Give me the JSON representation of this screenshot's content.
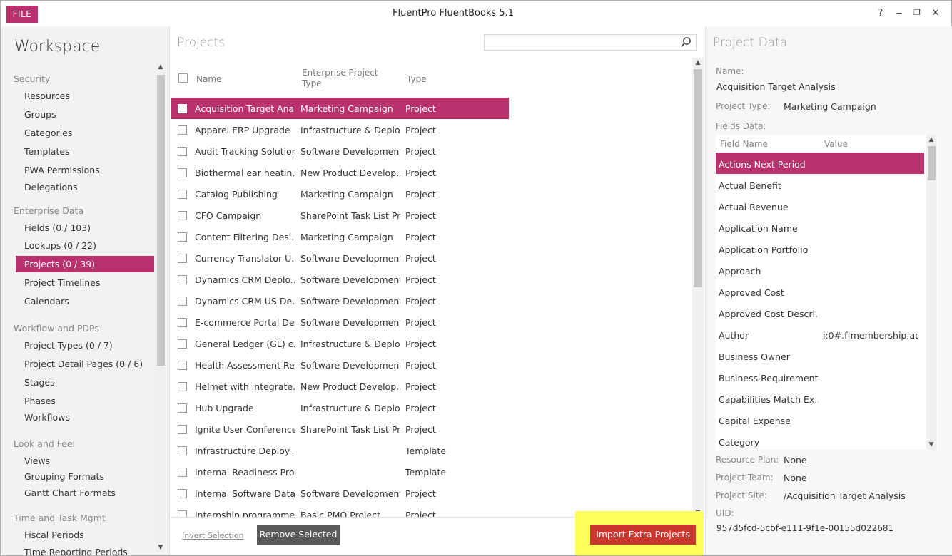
{
  "window": {
    "file_label": "FILE",
    "title": "FluentPro FluentBooks 5.1",
    "controls": [
      "?",
      "‒",
      "❐",
      "✕"
    ]
  },
  "sidebar": {
    "title": "Workspace",
    "groups": [
      {
        "label": "Security",
        "items": [
          "Resources",
          "Groups",
          "Categories",
          "Templates",
          "PWA Permissions",
          "Delegations"
        ]
      },
      {
        "label": "Enterprise Data",
        "items": [
          "Fields (0 / 103)",
          "Lookups (0 / 22)",
          "Projects (0 / 39)",
          "Project Timelines",
          "Calendars"
        ]
      },
      {
        "label": "Workflow and PDPs",
        "items": [
          "Project Types (0 / 7)",
          "Project Detail Pages (0 / 6)",
          "Stages",
          "Phases",
          "Workflows"
        ]
      },
      {
        "label": "Look and Feel",
        "items": [
          "Views",
          "Grouping Formats",
          "Gantt Chart Formats"
        ]
      },
      {
        "label": "Time and Task Mgmt",
        "items": [
          "Fiscal Periods",
          "Time Reporting Periods"
        ]
      }
    ],
    "selected": "Projects (0 / 39)"
  },
  "projects": {
    "title": "Projects",
    "search_placeholder": "",
    "columns": {
      "name": "Name",
      "ept_line1": "Enterprise Project",
      "ept_line2": "Type",
      "type": "Type"
    },
    "rows": [
      {
        "name": "Acquisition Target Ana...",
        "ept": "Marketing Campaign",
        "type": "Project"
      },
      {
        "name": "Apparel ERP Upgrade",
        "ept": "Infrastructure & Deplo...",
        "type": "Project"
      },
      {
        "name": "Audit Tracking Solution",
        "ept": "Software Development",
        "type": "Project"
      },
      {
        "name": "Biothermal ear heatin...",
        "ept": "New Product Develop...",
        "type": "Project"
      },
      {
        "name": "Catalog Publishing",
        "ept": "Marketing Campaign",
        "type": "Project"
      },
      {
        "name": "CFO Campaign",
        "ept": "SharePoint Task List Pr...",
        "type": "Project"
      },
      {
        "name": "Content Filtering Desi...",
        "ept": "Marketing Campaign",
        "type": "Project"
      },
      {
        "name": "Currency Translator U...",
        "ept": "Software Development",
        "type": "Project"
      },
      {
        "name": "Dynamics CRM Deplo...",
        "ept": "Software Development",
        "type": "Project"
      },
      {
        "name": "Dynamics CRM US De...",
        "ept": "Software Development",
        "type": "Project"
      },
      {
        "name": "E-commerce Portal De...",
        "ept": "Software Development",
        "type": "Project"
      },
      {
        "name": "General Ledger (GL) c...",
        "ept": "Infrastructure & Deplo...",
        "type": "Project"
      },
      {
        "name": "Health Assessment Re...",
        "ept": "Software Development",
        "type": "Project"
      },
      {
        "name": "Helmet with integrate...",
        "ept": "New Product Develop...",
        "type": "Project"
      },
      {
        "name": "Hub Upgrade",
        "ept": "Infrastructure & Deplo...",
        "type": "Project"
      },
      {
        "name": "Ignite User Conference",
        "ept": "SharePoint Task List Pr...",
        "type": "Project"
      },
      {
        "name": "Infrastructure Deploy...",
        "ept": "",
        "type": "Template"
      },
      {
        "name": "Internal Readiness Pro...",
        "ept": "",
        "type": "Template"
      },
      {
        "name": "Internal Software Data...",
        "ept": "Software Development",
        "type": "Project"
      },
      {
        "name": "Internship programme...",
        "ept": "Basic PMO Project",
        "type": "Project"
      }
    ],
    "invert_selection": "Invert Selection",
    "remove_selected": "Remove Selected",
    "import_extra": "Import Extra Projects"
  },
  "project_data": {
    "title": "Project Data",
    "name_label": "Name:",
    "name_value": "Acquisition Target Analysis",
    "type_label": "Project Type:",
    "type_value": "Marketing Campaign",
    "fields_label": "Fields Data:",
    "fields_columns": {
      "name": "Field Name",
      "value": "Value"
    },
    "fields": [
      {
        "name": "Actions Next Period",
        "value": ""
      },
      {
        "name": "Actual Benefit",
        "value": ""
      },
      {
        "name": "Actual Revenue",
        "value": ""
      },
      {
        "name": "Application Name",
        "value": ""
      },
      {
        "name": "Application Portfolio",
        "value": ""
      },
      {
        "name": "Approach",
        "value": ""
      },
      {
        "name": "Approved Cost",
        "value": ""
      },
      {
        "name": "Approved Cost Descri...",
        "value": ""
      },
      {
        "name": "Author",
        "value": "i:0#.f|membership|ad..."
      },
      {
        "name": "Business Owner",
        "value": ""
      },
      {
        "name": "Business Requirement...",
        "value": ""
      },
      {
        "name": "Capabilities Match Ex...",
        "value": ""
      },
      {
        "name": "Capital Expense",
        "value": ""
      },
      {
        "name": "Category",
        "value": ""
      }
    ],
    "resource_plan_label": "Resource Plan:",
    "resource_plan_value": "None",
    "team_label": "Project Team:",
    "team_value": "None",
    "site_label": "Project Site:",
    "site_value": "/Acquisition Target Analysis",
    "uid_label": "UID:",
    "uid_value": "957d5fcd-5cbf-e111-9f1e-00155d022681"
  }
}
